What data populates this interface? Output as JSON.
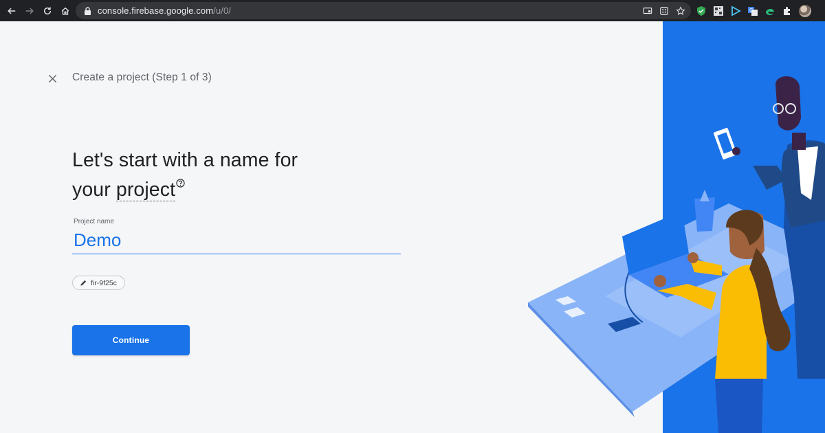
{
  "browser": {
    "url_host": "console.firebase.google.com",
    "url_path": "/u/0/"
  },
  "page": {
    "step_title": "Create a project (Step 1 of 3)",
    "headline_line1": "Let's start with a name for",
    "headline_prefix": "your ",
    "headline_term": "project"
  },
  "form": {
    "project_name_label": "Project name",
    "project_name_value": "Demo",
    "project_id": "fir-9f25c",
    "continue_label": "Continue"
  },
  "colors": {
    "accent": "#1a73e8",
    "toolbar": "#202124",
    "background": "#f5f6f8",
    "panel": "#1a73e8"
  }
}
